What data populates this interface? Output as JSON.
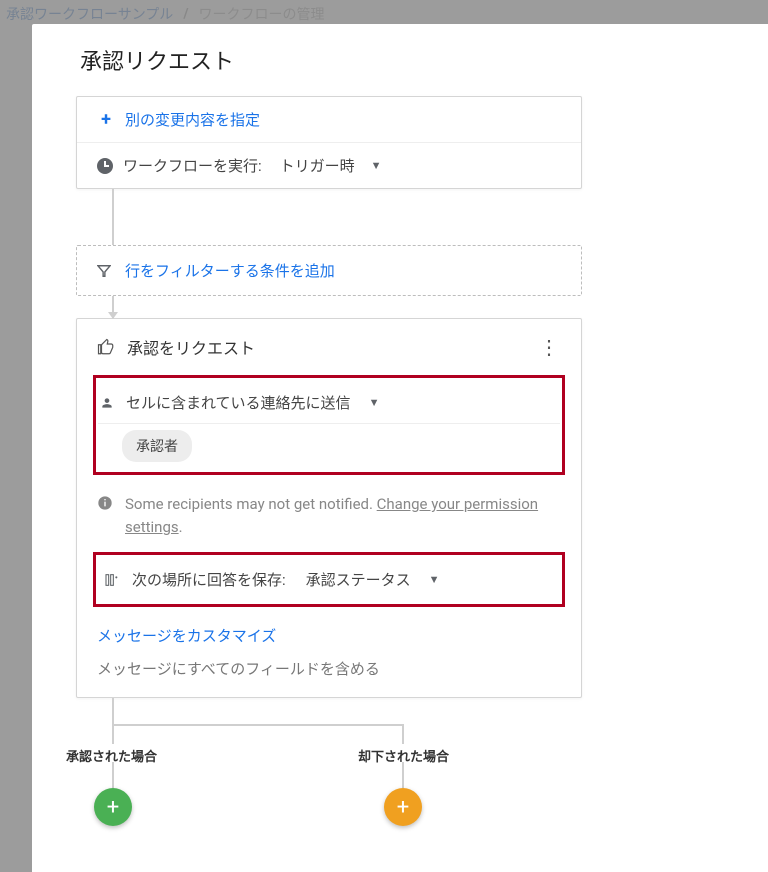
{
  "bg_breadcrumb": {
    "link": "承認ワークフローサンプル",
    "sep": "/",
    "current": "ワークフローの管理"
  },
  "modal": {
    "title": "承認リクエスト"
  },
  "trigger_card": {
    "add_change_label": "別の変更内容を指定",
    "run_label": "ワークフローを実行:",
    "run_value": "トリガー時"
  },
  "filter_card": {
    "label": "行をフィルターする条件を追加"
  },
  "approval": {
    "title": "承認をリクエスト",
    "send_label": "セルに含まれている連絡先に送信",
    "approver_chip": "承認者",
    "info_text_a": "Some recipients may not get notified.  ",
    "info_link": "Change your permission settings",
    "info_period": ".",
    "save_label": "次の場所に回答を保存:",
    "save_value": "承認ステータス",
    "customize_label": "メッセージをカスタマイズ",
    "include_fields_label": "メッセージにすべてのフィールドを含める"
  },
  "branches": {
    "approved_label": "承認された場合",
    "declined_label": "却下された場合"
  }
}
